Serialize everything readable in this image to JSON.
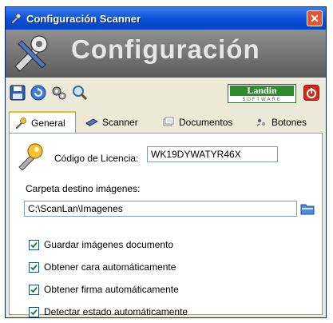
{
  "window": {
    "title": "Configuración Scanner",
    "close_icon": "close-icon"
  },
  "banner": {
    "heading": "Configuración",
    "icon": "wrench-screwdriver-icon"
  },
  "toolbar": {
    "buttons": [
      {
        "icon": "save-icon"
      },
      {
        "icon": "refresh-icon"
      },
      {
        "icon": "settings-gears-icon"
      },
      {
        "icon": "search-icon"
      }
    ],
    "logo": {
      "brand": "Landin",
      "tagline": "SOFTWARE"
    },
    "power_icon": "power-icon"
  },
  "tabs": [
    {
      "label": "General",
      "icon": "wrench-icon",
      "active": true
    },
    {
      "label": "Scanner",
      "icon": "scanner-icon",
      "active": false
    },
    {
      "label": "Documentos",
      "icon": "documents-icon",
      "active": false
    },
    {
      "label": "Botones",
      "icon": "buttons-icon",
      "active": false
    }
  ],
  "general": {
    "license_label": "Código de Licencia:",
    "license_value": "WK19DYWATYR46X",
    "folder_label": "Carpeta destino imágenes:",
    "folder_value": "C:\\ScanLan\\Imagenes",
    "options": [
      {
        "label": "Guardar imágenes documento",
        "checked": true
      },
      {
        "label": "Obtener cara automáticamente",
        "checked": true
      },
      {
        "label": "Obtener firma automáticamente",
        "checked": true
      },
      {
        "label": "Detectar estado automáticamente",
        "checked": true
      }
    ]
  },
  "colors": {
    "title_bar": "#0a4fd6",
    "logo_green": "#2e8b2e",
    "power_red": "#d42a1a"
  }
}
